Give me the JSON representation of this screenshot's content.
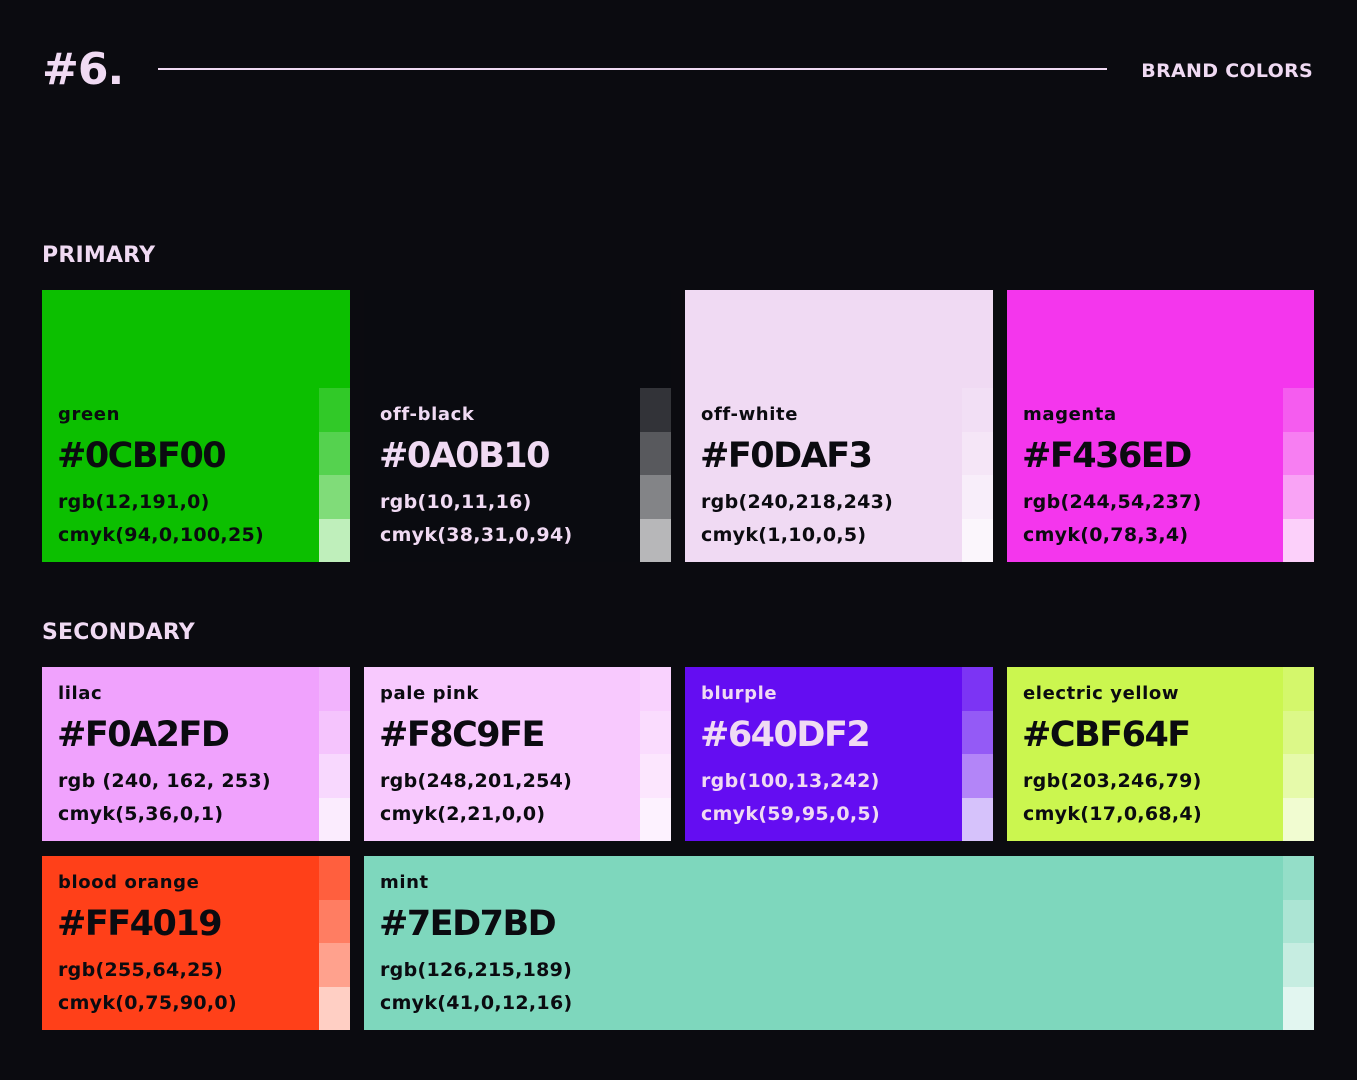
{
  "header": {
    "number": "#6.",
    "title": "BRAND COLORS"
  },
  "groups": {
    "primary": "PRIMARY",
    "secondary": "SECONDARY"
  },
  "swatches": {
    "green": {
      "name": "green",
      "hex": "#0CBF00",
      "rgb": "rgb(12,191,0)",
      "cmyk": "cmyk(94,0,100,25)",
      "color": "#0cbf00",
      "text_color": "#0b0b10",
      "tints": [
        "#31c928",
        "#55d24f",
        "#80dc79",
        "#bfefbb"
      ]
    },
    "off_black": {
      "name": "off-black",
      "hex": "#0A0B10",
      "rgb": "rgb(10,11,16)",
      "cmyk": "cmyk(38,31,0,94)",
      "color": "#0a0b10",
      "text_color": "#f0daf3",
      "tints": [
        "#323338",
        "#58595d",
        "#838487",
        "#b7b7b9"
      ]
    },
    "off_white": {
      "name": "off-white",
      "hex": "#F0DAF3",
      "rgb": "rgb(240,218,243)",
      "cmyk": "cmyk(1,10,0,5)",
      "color": "#f0daf3",
      "text_color": "#0b0b10",
      "tints": [
        "#f2dff5",
        "#f5e6f7",
        "#f8eefa",
        "#fbf6fc"
      ]
    },
    "magenta": {
      "name": "magenta",
      "hex": "#F436ED",
      "rgb": "rgb(244,54,237)",
      "cmyk": "cmyk(0,78,3,4)",
      "color": "#f436ed",
      "text_color": "#0b0b10",
      "tints": [
        "#f55cef",
        "#f77ef2",
        "#f9a3f5",
        "#fcd0fa"
      ]
    },
    "lilac": {
      "name": "lilac",
      "hex": "#F0A2FD",
      "rgb": "rgb (240, 162, 253)",
      "cmyk": "cmyk(5,36,0,1)",
      "color": "#f0a2fd",
      "text_color": "#0b0b10",
      "tints": [
        "#f2b3fd",
        "#f5c4fd",
        "#f8d8fe",
        "#fbecfe"
      ]
    },
    "pale_pink": {
      "name": "pale pink",
      "hex": "#F8C9FE",
      "rgb": "rgb(248,201,254)",
      "cmyk": "cmyk(2,21,0,0)",
      "color": "#f8c9fe",
      "text_color": "#0b0b10",
      "tints": [
        "#f9d2fe",
        "#fadcfe",
        "#fce6fe",
        "#fdf2ff"
      ]
    },
    "blurple": {
      "name": "blurple",
      "hex": "#640DF2",
      "rgb": "rgb(100,13,242)",
      "cmyk": "cmyk(59,95,0,5)",
      "color": "#640df2",
      "text_color": "#f0daf3",
      "tints": [
        "#7c34f4",
        "#945af6",
        "#b385f8",
        "#d6c2fb"
      ]
    },
    "electric_yellow": {
      "name": "electric yellow",
      "hex": "#CBF64F",
      "rgb": "rgb(203,246,79)",
      "cmyk": "cmyk(17,0,68,4)",
      "color": "#cbf64f",
      "text_color": "#0b0b10",
      "tints": [
        "#d4f76b",
        "#dcf888",
        "#e6faaa",
        "#f1fcd1"
      ]
    },
    "blood_orange": {
      "name": "blood orange",
      "hex": "#FF4019",
      "rgb": "rgb(255,64,25)",
      "cmyk": "cmyk(0,75,90,0)",
      "color": "#ff4019",
      "text_color": "#0b0b10",
      "tints": [
        "#ff5f3e",
        "#ff7d62",
        "#ffa18d",
        "#ffcfc4"
      ]
    },
    "mint": {
      "name": "mint",
      "hex": "#7ED7BD",
      "rgb": "rgb(126,215,189)",
      "cmyk": "cmyk(41,0,12,16)",
      "color": "#7ed7bd",
      "text_color": "#0b0b10",
      "tints": [
        "#94dec8",
        "#ace5d4",
        "#c6ede1",
        "#e2f6f0"
      ]
    }
  }
}
